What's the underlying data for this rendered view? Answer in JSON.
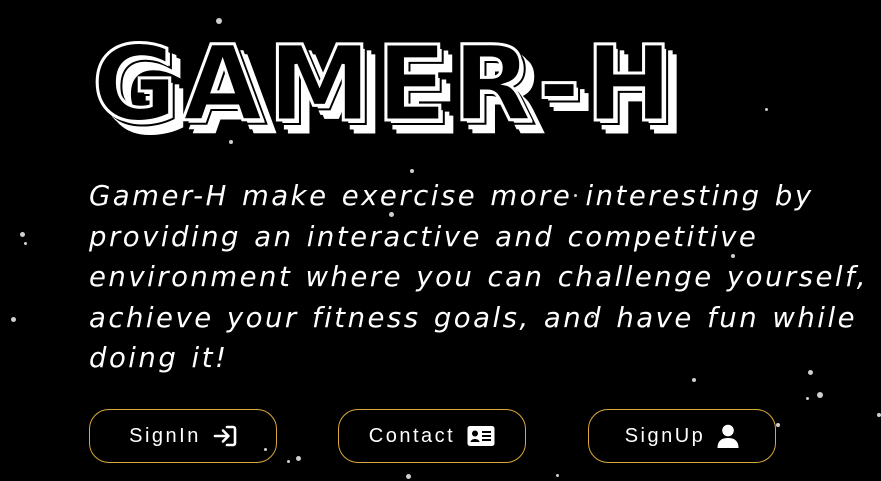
{
  "hero": {
    "logo_text": "GAMER-H",
    "tagline": "Gamer-H make exercise more interesting by providing an interactive and competitive environment where you can challenge yourself, achieve your fitness goals, and have fun while doing it!"
  },
  "buttons": [
    {
      "label": "SignIn",
      "icon": "sign-in-arrow-icon"
    },
    {
      "label": "Contact",
      "icon": "contact-card-icon"
    },
    {
      "label": "SignUp",
      "icon": "user-icon"
    }
  ],
  "colors": {
    "background": "#000000",
    "text": "#ffffff",
    "button_border": "#d9a93a"
  }
}
